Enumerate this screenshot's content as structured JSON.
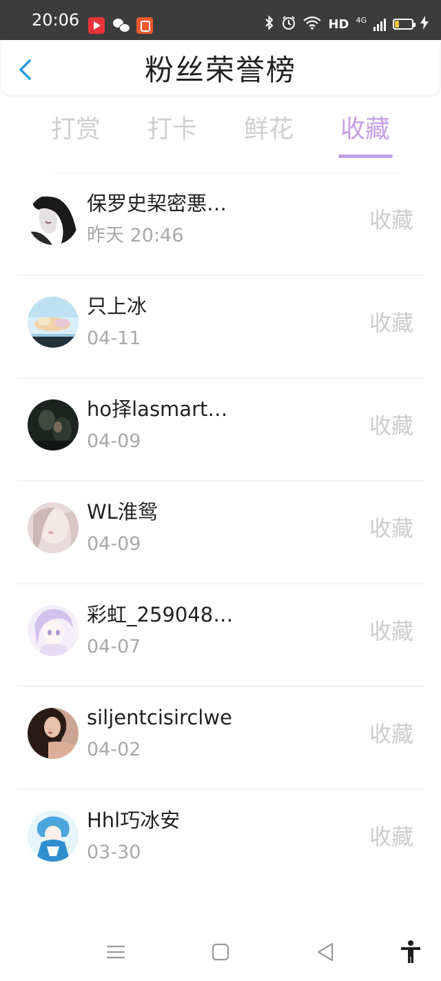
{
  "status_bar": {
    "time": "20:06",
    "app_icons": [
      "video-app-icon",
      "wechat-icon",
      "kuaishou-app-icon"
    ],
    "right_icons": [
      "bluetooth-icon",
      "alarm-icon",
      "wifi-icon",
      "signal-icon",
      "battery-icon",
      "charging-icon"
    ],
    "hd_label": "HD",
    "network_label": "4G"
  },
  "header": {
    "title": "粉丝荣誉榜",
    "back_icon": "chevron-left-icon"
  },
  "tabs": [
    {
      "label": "打赏",
      "active": false
    },
    {
      "label": "打卡",
      "active": false
    },
    {
      "label": "鲜花",
      "active": false
    },
    {
      "label": "收藏",
      "active": true
    }
  ],
  "list": {
    "items": [
      {
        "name": "保罗史栔密悪…",
        "date": "昨天 20:46",
        "action": "收藏"
      },
      {
        "name": "只上冰",
        "date": "04-11",
        "action": "收藏"
      },
      {
        "name": "ho择lasmart…",
        "date": "04-09",
        "action": "收藏"
      },
      {
        "name": "WL淮鸳",
        "date": "04-09",
        "action": "收藏"
      },
      {
        "name": "彩虹_259048…",
        "date": "04-07",
        "action": "收藏"
      },
      {
        "name": "siljentcisirclwe",
        "date": "04-02",
        "action": "收藏"
      },
      {
        "name": "Hhl巧冰安",
        "date": "03-30",
        "action": "收藏"
      }
    ]
  },
  "bottom_nav": [
    "menu-icon",
    "home-icon",
    "back-icon",
    "accessibility-icon"
  ],
  "colors": {
    "accent": "#c69ee6",
    "back_arrow": "#2a9bd8",
    "status_bar_bg": "#3c3c3c",
    "inactive_tab": "#cfcfcf",
    "secondary_text": "#a8a8a8"
  }
}
